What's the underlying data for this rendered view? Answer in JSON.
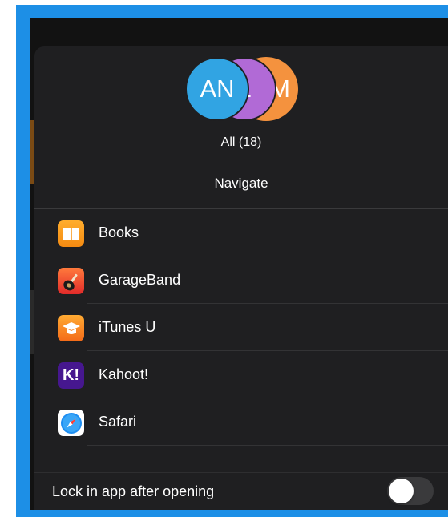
{
  "header": {
    "avatars": [
      {
        "initials": "AN",
        "color": "#31a4e3"
      },
      {
        "initials": "L",
        "color": "#b16ad6"
      },
      {
        "initials": "M",
        "color": "#f4923e"
      }
    ],
    "all_label": "All (18)",
    "title": "Navigate"
  },
  "apps": [
    {
      "name": "Books",
      "icon": "books-icon"
    },
    {
      "name": "GarageBand",
      "icon": "garageband-icon"
    },
    {
      "name": "iTunes U",
      "icon": "itunes-u-icon"
    },
    {
      "name": "Kahoot!",
      "icon": "kahoot-icon",
      "icon_text": "K!"
    },
    {
      "name": "Safari",
      "icon": "safari-icon"
    }
  ],
  "footer": {
    "lock_label": "Lock in app after opening",
    "lock_enabled": false
  },
  "colors": {
    "frame": "#1d8fe6",
    "sheet": "#1f1f21"
  }
}
